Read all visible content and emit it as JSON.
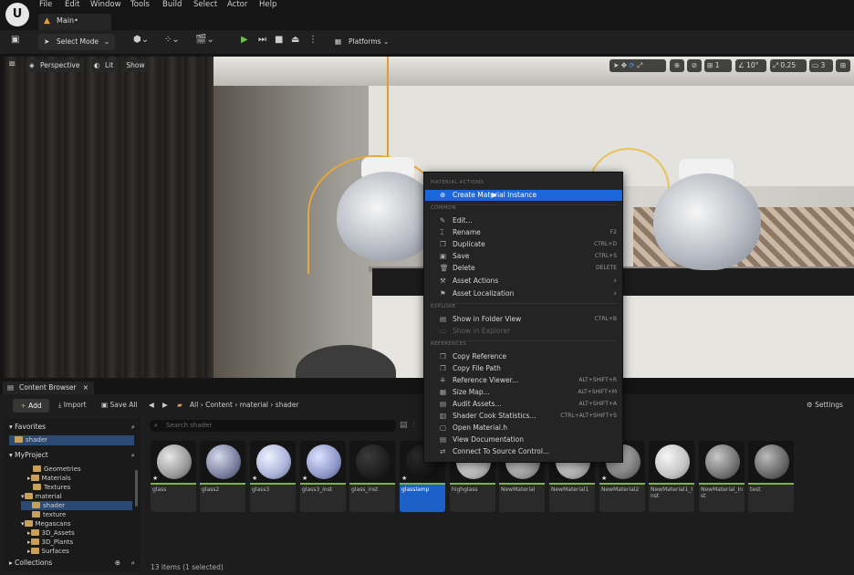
{
  "menubar": {
    "items": [
      "File",
      "Edit",
      "Window",
      "Tools",
      "Build",
      "Select",
      "Actor",
      "Help"
    ],
    "tab": "Main•"
  },
  "toolbar": {
    "select_mode": "Select Mode",
    "platforms": "Platforms"
  },
  "viewport": {
    "perspective": "Perspective",
    "lit": "Lit",
    "show": "Show",
    "grid_value": "1",
    "angle_value": "10°",
    "scale_value": "0.25",
    "camera_value": "3"
  },
  "content_browser": {
    "tab": "Content Browser",
    "add": "Add",
    "import": "Import",
    "save_all": "Save All",
    "breadcrumb": [
      "All",
      "Content",
      "material",
      "shader"
    ],
    "settings": "Settings",
    "search_placeholder": "Search shader",
    "favorites": "Favorites",
    "favorite_item": "shader",
    "project": "MyProject",
    "tree": [
      "Geometries",
      "Materials",
      "Textures",
      "material",
      "shader",
      "texture",
      "Megascans",
      "3D_Assets",
      "3D_Plants",
      "Surfaces"
    ],
    "collections": "Collections",
    "status": "13 items (1 selected)",
    "assets": [
      "glass",
      "glass2",
      "glass3",
      "glass3_inst",
      "glass_inst",
      "glasslamp",
      "highglass",
      "NewMaterial",
      "NewMaterial1",
      "NewMaterial2",
      "NewMaterial1_Inst",
      "NewMaterial_Inst",
      "test"
    ]
  },
  "context_menu": {
    "headers": [
      "MATERIAL ACTIONS",
      "COMMON",
      "EXPLORE",
      "REFERENCES"
    ],
    "material_actions": [
      {
        "label": "Create Material Instance",
        "shortcut": ""
      }
    ],
    "common": [
      {
        "label": "Edit...",
        "shortcut": ""
      },
      {
        "label": "Rename",
        "shortcut": "F2"
      },
      {
        "label": "Duplicate",
        "shortcut": "CTRL+D"
      },
      {
        "label": "Save",
        "shortcut": "CTRL+S"
      },
      {
        "label": "Delete",
        "shortcut": "DELETE"
      },
      {
        "label": "Asset Actions",
        "shortcut": ""
      },
      {
        "label": "Asset Localization",
        "shortcut": ""
      }
    ],
    "explore": [
      {
        "label": "Show in Folder View",
        "shortcut": "CTRL+B"
      },
      {
        "label": "Show in Explorer",
        "shortcut": ""
      }
    ],
    "references": [
      {
        "label": "Copy Reference",
        "shortcut": ""
      },
      {
        "label": "Copy File Path",
        "shortcut": ""
      },
      {
        "label": "Reference Viewer...",
        "shortcut": "ALT+SHIFT+R"
      },
      {
        "label": "Size Map...",
        "shortcut": "ALT+SHIFT+M"
      },
      {
        "label": "Audit Assets...",
        "shortcut": "ALT+SHIFT+A"
      },
      {
        "label": "Shader Cook Statistics...",
        "shortcut": "CTRL+ALT+SHIFT+S"
      },
      {
        "label": "Open Material.h",
        "shortcut": ""
      },
      {
        "label": "View Documentation",
        "shortcut": ""
      },
      {
        "label": "Connect To Source Control...",
        "shortcut": ""
      }
    ]
  }
}
